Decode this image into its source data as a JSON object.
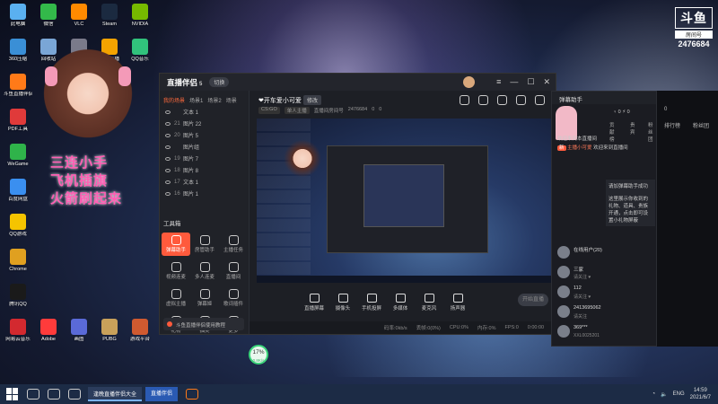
{
  "desktop": {
    "icons": [
      {
        "label": "此电脑",
        "color": "#5ab0f0"
      },
      {
        "label": "360压缩",
        "color": "#3a8fd6"
      },
      {
        "label": "斗鱼直播伴侣",
        "color": "#ff7a18"
      },
      {
        "label": "PDF工具",
        "color": "#e03a3a"
      },
      {
        "label": "WeGame",
        "color": "#2fb34a"
      },
      {
        "label": "百度网盘",
        "color": "#3a8ff0"
      },
      {
        "label": "QQ游戏",
        "color": "#f5c400"
      },
      {
        "label": "Chrome",
        "color": "#e0a020"
      },
      {
        "label": "腾讯QQ",
        "color": "#1a1a1a"
      },
      {
        "label": "网易云音乐",
        "color": "#d3292f"
      },
      {
        "label": "微信",
        "color": "#33b94a"
      },
      {
        "label": "回收站",
        "color": "#7aa6d6"
      },
      {
        "label": "VLC",
        "color": "#ff8a00"
      },
      {
        "label": "设置中心",
        "color": "#7a7a8a"
      },
      {
        "label": "Steam",
        "color": "#1b2a40"
      },
      {
        "label": "虎牙直播",
        "color": "#f4a300"
      },
      {
        "label": "NVIDIA",
        "color": "#76b900"
      },
      {
        "label": "QQ音乐",
        "color": "#31c27c"
      },
      {
        "label": "Adobe",
        "color": "#ff3b3b"
      },
      {
        "label": "画图",
        "color": "#5a6ad8"
      },
      {
        "label": "PUBG",
        "color": "#c9a15a"
      },
      {
        "label": "游戏平台",
        "color": "#d05a30"
      }
    ],
    "promo_lines": [
      "三连小手",
      "飞机插旗",
      "火箭刷起来"
    ],
    "douyu": {
      "logo": "斗鱼",
      "sub": "房间号",
      "room": "2476684"
    }
  },
  "app": {
    "brand": "直播伴侣",
    "version": "5",
    "switch_label": "切换",
    "scene_tabs": [
      "我的场景",
      "场景1",
      "场景2",
      "场景"
    ],
    "sources": [
      {
        "num": "",
        "name": "文本 1"
      },
      {
        "num": "21",
        "name": "图片 22"
      },
      {
        "num": "20",
        "name": "图片 5"
      },
      {
        "num": "",
        "name": "图片组"
      },
      {
        "num": "19",
        "name": "图片 7"
      },
      {
        "num": "18",
        "name": "图片 8"
      },
      {
        "num": "17",
        "name": "文本 1"
      },
      {
        "num": "16",
        "name": "图片 1"
      }
    ],
    "tools_title": "工具箱",
    "tools": [
      {
        "label": "弹幕助手",
        "active": true
      },
      {
        "label": "房管助手",
        "active": false
      },
      {
        "label": "主播任务",
        "active": false
      },
      {
        "label": "视频连麦",
        "active": false
      },
      {
        "label": "多人连麦",
        "active": false
      },
      {
        "label": "直播间",
        "active": false
      },
      {
        "label": "虚拟主播",
        "active": false
      },
      {
        "label": "弹幕姬",
        "active": false
      },
      {
        "label": "歌词插件",
        "active": false
      },
      {
        "label": "礼物",
        "active": false
      },
      {
        "label": "抽奖",
        "active": false
      },
      {
        "label": "更多",
        "active": false
      }
    ],
    "notice": "斗鱼直播伴侣使用教程",
    "room_title": "❤开车爱小可爱",
    "edit_label": "修改",
    "room_info": [
      "CS:GO",
      "单人主播",
      "直播间房间号",
      "2476684",
      "0",
      "0"
    ],
    "controls": [
      "直播屏幕",
      "摄像头",
      "手机投屏",
      "多媒体",
      "麦克风",
      "扬声器"
    ],
    "start_label": "开始直播",
    "status": [
      "码率:0kb/s",
      "丢帧:0(0%)",
      "CPU:0%",
      "内存:0%",
      "FPS:0",
      "0:00:00"
    ]
  },
  "chat": {
    "title": "弹幕助手",
    "stats": "♀ 0   ⚡ 0",
    "tabs": [
      "贡献榜",
      "贵宾",
      "粉丝团"
    ],
    "lines": [
      {
        "tag": "",
        "name": "",
        "text": "欢迎来到本直播间"
      },
      {
        "tag": "新",
        "name": "主播小可爱",
        "text": "欢迎来到直播间"
      }
    ],
    "sysmsg": "请加弹幕助手成功\n\n这里展示你收到的礼物、道具、贵族开通，点击即可设置小礼物屏蔽",
    "users": [
      {
        "name": "在线用户(20)",
        "sub": ""
      },
      {
        "name": "三家",
        "sub": "请关注 ♥"
      },
      {
        "name": "112",
        "sub": "请关注 ♥"
      },
      {
        "name": "2413695062",
        "sub": "请关注"
      },
      {
        "name": "369***",
        "sub": "XXL0025201"
      }
    ]
  },
  "rightpanel": {
    "items": [
      "0",
      "排行榜",
      "贵宾",
      "粉丝团"
    ]
  },
  "speedometer": {
    "value": "17%",
    "sub": "0.8K/s"
  },
  "taskbar": {
    "app1": "逢晚直播伴侣大全",
    "app2": "直播伴侣",
    "tray": [
      "ENG"
    ],
    "time": "14:59",
    "date": "2021/6/7"
  }
}
